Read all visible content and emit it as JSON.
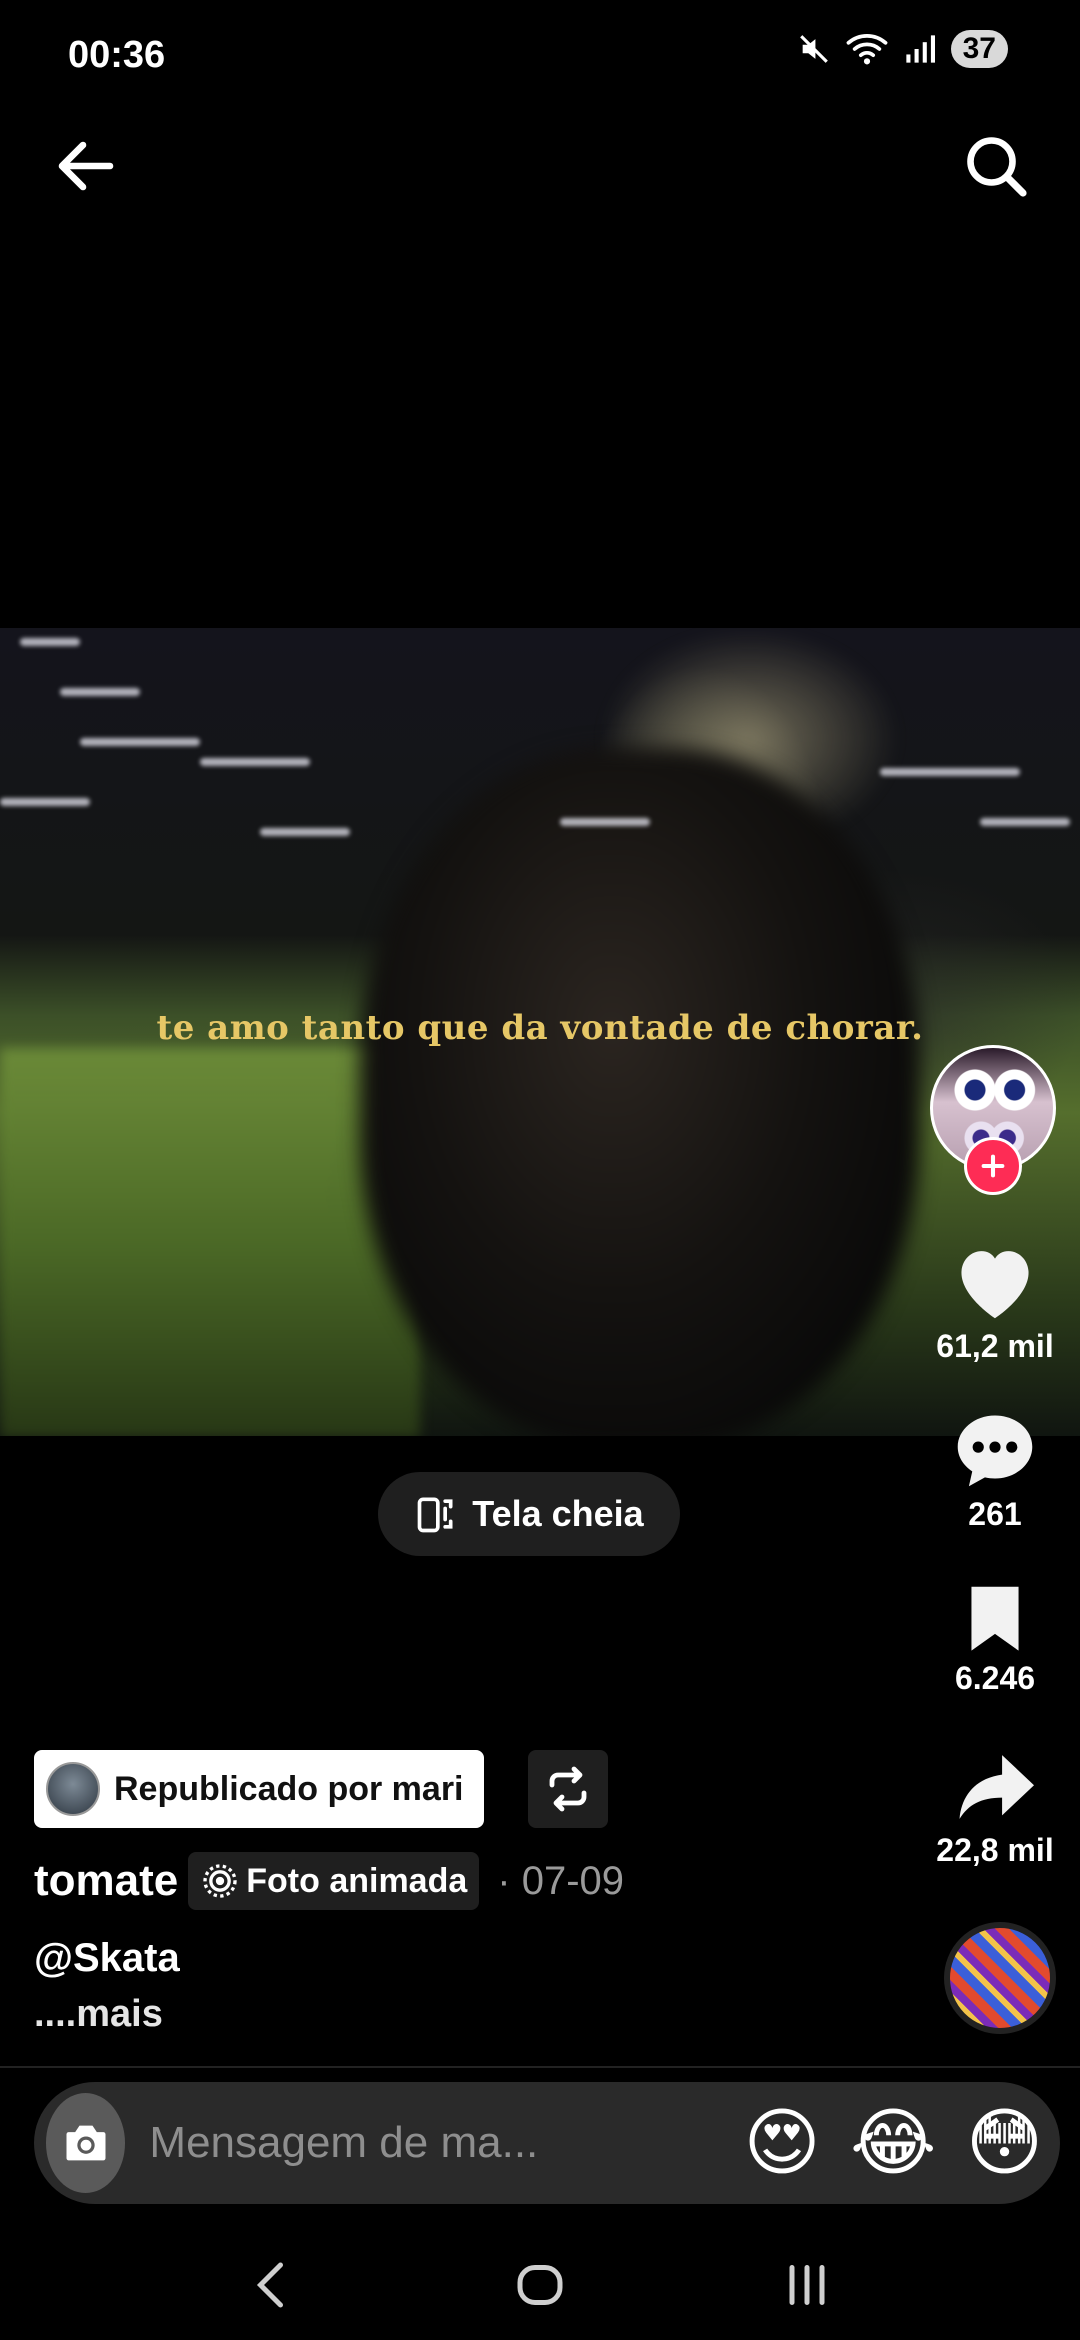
{
  "status_bar": {
    "time": "00:36",
    "battery": "37"
  },
  "video": {
    "caption": "te amo tanto que da vontade de chorar."
  },
  "fullscreen": {
    "label": "Tela cheia"
  },
  "actions": {
    "likes": "61,2 mil",
    "comments": "261",
    "saves": "6.246",
    "shares": "22,8 mil"
  },
  "repost": {
    "label": "Republicado por mari"
  },
  "post": {
    "username": "tomate",
    "badge": "Foto animada",
    "date": "· 07-09",
    "description": "@Skata",
    "more": "....mais"
  },
  "message": {
    "placeholder": "Mensagem de ma...",
    "quick_emojis": [
      "😍",
      "😂",
      "😳"
    ]
  },
  "icons": {
    "back": "arrow-left-icon",
    "search": "search-icon",
    "like": "heart-icon",
    "comment": "comment-icon",
    "save": "bookmark-icon",
    "share": "share-icon",
    "camera": "camera-icon"
  },
  "colors": {
    "accent_red": "#fe2c55",
    "caption_yellow": "#e6c766"
  }
}
